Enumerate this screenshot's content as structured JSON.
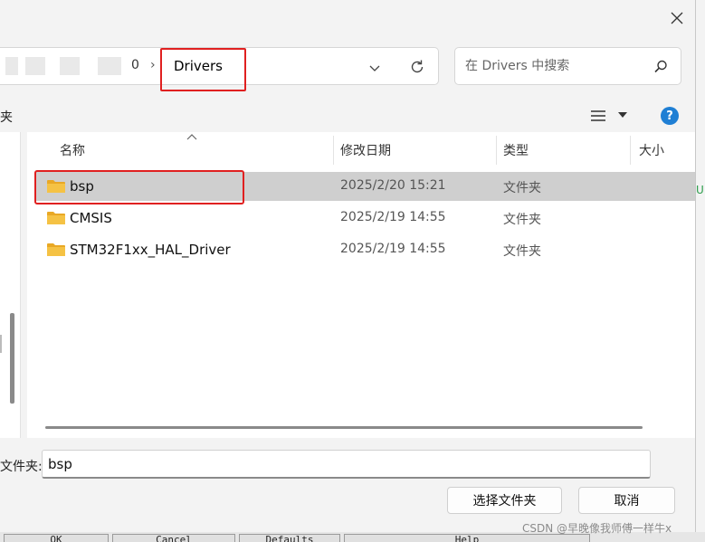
{
  "toolbar": {
    "breadcrumb_tail": "0",
    "breadcrumb_sep": "›",
    "current_folder": "Drivers",
    "search_placeholder": "在 Drivers 中搜索",
    "folder_label_partial": "夹"
  },
  "columns": {
    "name": "名称",
    "date": "修改日期",
    "type": "类型",
    "size": "大小"
  },
  "files": [
    {
      "name": "bsp",
      "date": "2025/2/20 15:21",
      "type": "文件夹"
    },
    {
      "name": "CMSIS",
      "date": "2025/2/19 14:55",
      "type": "文件夹"
    },
    {
      "name": "STM32F1xx_HAL_Driver",
      "date": "2025/2/19 14:55",
      "type": "文件夹"
    }
  ],
  "footer": {
    "folder_label": "文件夹:",
    "folder_value": "bsp",
    "select_button": "选择文件夹",
    "cancel_button": "取消"
  },
  "background_buttons": [
    "OK",
    "Cancel",
    "Defaults",
    "Help"
  ],
  "side_glyph": "U",
  "watermark": "CSDN @早晚像我师傅一样牛x",
  "colors": {
    "highlight_border": "#e02020",
    "selected_row": "#cfcfcf",
    "help_icon": "#1f7fd4",
    "folder_icon": "#f5c244"
  }
}
